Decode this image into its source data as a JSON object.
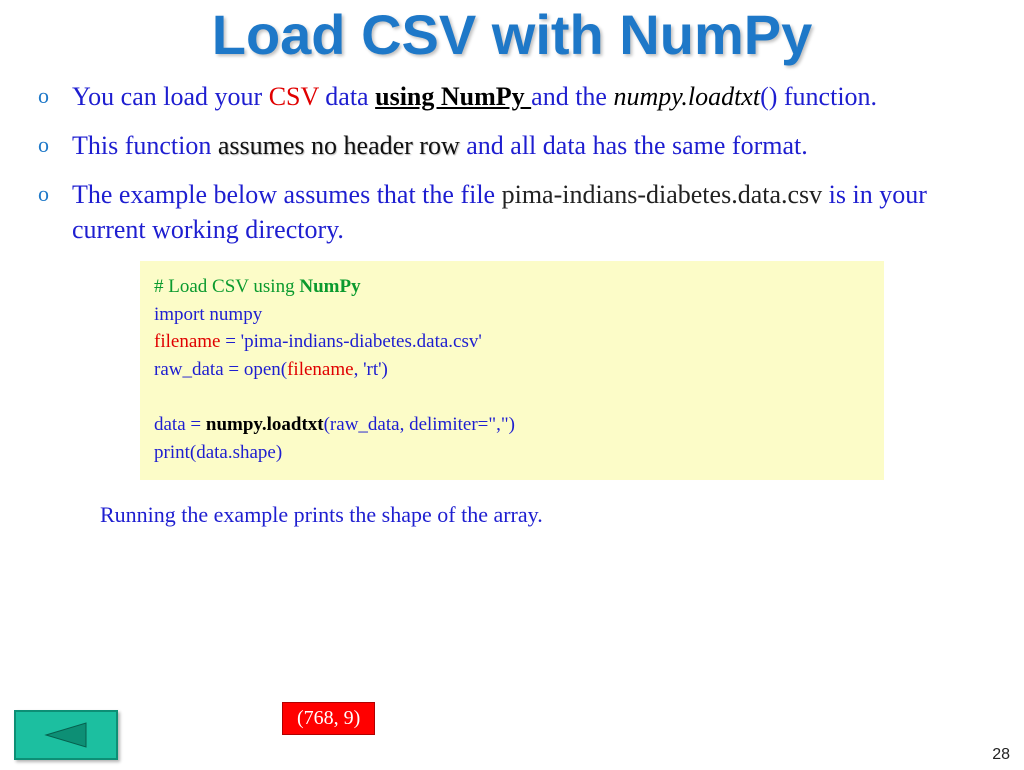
{
  "title": "Load CSV with NumPy",
  "bullets": {
    "b1": {
      "t1": "You can load your ",
      "csv": "CSV",
      "t2": " data ",
      "numpy": "using NumPy ",
      "t3": "and the ",
      "fn": "numpy.loadtxt",
      "paren": "()",
      "t4": " function."
    },
    "b2": {
      "t1": "This function ",
      "assume": "assumes no header row",
      "t2": " and all data has the same format."
    },
    "b3": {
      "t1": "The example below assumes that the file ",
      "file": "pima-indians-diabetes.data.csv",
      "t2": " is in your current working directory."
    }
  },
  "code": {
    "l1a": "# Load CSV using ",
    "l1b": "NumPy",
    "l2": "import numpy",
    "l3a": "filename",
    "l3b": " = 'pima-indians-diabetes.data.csv'",
    "l4a": "raw_data = open(",
    "l4b": "filename",
    "l4c": ", 'rt')",
    "l6a": "data = ",
    "l6b": "numpy.loadtxt",
    "l6c": "(raw_data, delimiter=\",\")",
    "l7": "print(data.shape)"
  },
  "caption": "Running the example prints the shape of the array.",
  "output": "(768, 9)",
  "page": "28"
}
